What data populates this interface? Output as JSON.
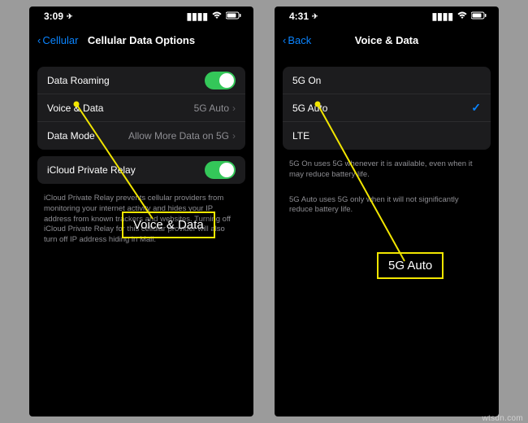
{
  "left": {
    "status": {
      "time": "3:09",
      "loc_arrow": "➤"
    },
    "nav": {
      "back": "Cellular",
      "title": "Cellular Data Options"
    },
    "group1": {
      "roaming": {
        "label": "Data Roaming",
        "on": true
      },
      "voice_data": {
        "label": "Voice & Data",
        "value": "5G Auto"
      },
      "data_mode": {
        "label": "Data Mode",
        "value": "Allow More Data on 5G"
      }
    },
    "group2": {
      "relay": {
        "label": "iCloud Private Relay",
        "on": true
      },
      "footer": "iCloud Private Relay prevents cellular providers from monitoring your internet activity and hides your IP address from known trackers and websites. Turning off iCloud Private Relay for this cellular provider will also turn off IP address hiding in Mail."
    },
    "callout": "Voice & Data"
  },
  "right": {
    "status": {
      "time": "4:31",
      "loc_arrow": "➤"
    },
    "nav": {
      "back": "Back",
      "title": "Voice & Data"
    },
    "options": {
      "o1": {
        "label": "5G On",
        "selected": false
      },
      "o2": {
        "label": "5G Auto",
        "selected": true
      },
      "o3": {
        "label": "LTE",
        "selected": false
      }
    },
    "footer1": "5G On uses 5G whenever it is available, even when it may reduce battery life.",
    "footer2": "5G Auto uses 5G only when it will not significantly reduce battery life.",
    "callout": "5G Auto"
  },
  "watermark": "wtsdn.com"
}
